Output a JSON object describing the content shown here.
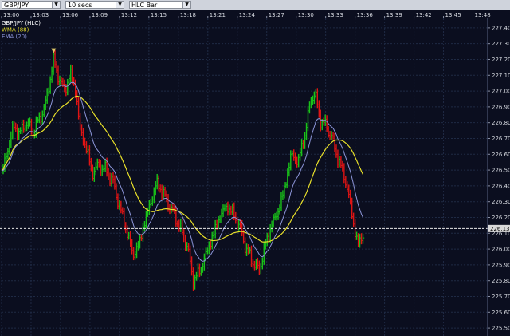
{
  "toolbar": {
    "symbol": "GBP/JPY",
    "interval": "10 secs",
    "style": "HLC Bar"
  },
  "colors": {
    "background": "#0b0e1f",
    "grid": "#1f2a44",
    "up_bar": "#19c219",
    "down_bar": "#e01414",
    "wma": "#e8e02a",
    "ema": "#8c95d8",
    "price_tag": "#d8d8d8"
  },
  "chart_data": {
    "type": "line",
    "title": "",
    "legend": [
      {
        "label": "GBP/JPY (HLC)",
        "color": "#ffffff"
      },
      {
        "label": "WMA (88)",
        "color": "#e8e02a"
      },
      {
        "label": "EMA (20)",
        "color": "#8c95d8"
      }
    ],
    "x_ticks": [
      "13:00",
      "13:03",
      "13:06",
      "13:09",
      "13:12",
      "13:15",
      "13:18",
      "13:21",
      "13:24",
      "13:27",
      "13:30",
      "13:33",
      "13:36",
      "13:39",
      "13:42",
      "13:45",
      "13:48"
    ],
    "y_ticks": [
      227.4,
      227.3,
      227.2,
      227.1,
      227.0,
      226.9,
      226.8,
      226.7,
      226.6,
      226.5,
      226.4,
      226.3,
      226.2,
      226.1,
      226.0,
      225.9,
      225.8,
      225.7,
      225.6,
      225.5
    ],
    "ylim": [
      225.45,
      227.46
    ],
    "xlim_minutes": [
      0,
      49.5
    ],
    "grid": true,
    "last_price": "226.13",
    "last_price_value": 226.13,
    "marker_peak": {
      "minute": 5.3,
      "price": 227.25
    },
    "price_path": [
      {
        "minute": 0.0,
        "price": 226.48
      },
      {
        "minute": 0.6,
        "price": 226.62
      },
      {
        "minute": 1.2,
        "price": 226.78
      },
      {
        "minute": 1.8,
        "price": 226.73
      },
      {
        "minute": 2.5,
        "price": 226.8
      },
      {
        "minute": 3.2,
        "price": 226.74
      },
      {
        "minute": 3.9,
        "price": 226.83
      },
      {
        "minute": 4.5,
        "price": 226.92
      },
      {
        "minute": 5.0,
        "price": 227.1
      },
      {
        "minute": 5.3,
        "price": 227.2
      },
      {
        "minute": 5.8,
        "price": 227.08
      },
      {
        "minute": 6.5,
        "price": 227.0
      },
      {
        "minute": 7.0,
        "price": 227.12
      },
      {
        "minute": 7.6,
        "price": 226.98
      },
      {
        "minute": 8.0,
        "price": 226.75
      },
      {
        "minute": 8.6,
        "price": 226.65
      },
      {
        "minute": 9.2,
        "price": 226.48
      },
      {
        "minute": 9.9,
        "price": 226.53
      },
      {
        "minute": 10.6,
        "price": 226.5
      },
      {
        "minute": 11.3,
        "price": 226.43
      },
      {
        "minute": 12.0,
        "price": 226.27
      },
      {
        "minute": 12.7,
        "price": 226.12
      },
      {
        "minute": 13.4,
        "price": 225.96
      },
      {
        "minute": 14.0,
        "price": 226.03
      },
      {
        "minute": 14.6,
        "price": 226.18
      },
      {
        "minute": 15.2,
        "price": 226.3
      },
      {
        "minute": 15.8,
        "price": 226.42
      },
      {
        "minute": 16.4,
        "price": 226.36
      },
      {
        "minute": 17.0,
        "price": 226.28
      },
      {
        "minute": 17.6,
        "price": 226.22
      },
      {
        "minute": 18.3,
        "price": 226.11
      },
      {
        "minute": 18.9,
        "price": 226.02
      },
      {
        "minute": 19.5,
        "price": 225.8
      },
      {
        "minute": 20.2,
        "price": 225.86
      },
      {
        "minute": 20.9,
        "price": 225.98
      },
      {
        "minute": 21.6,
        "price": 226.1
      },
      {
        "minute": 22.3,
        "price": 226.22
      },
      {
        "minute": 23.0,
        "price": 226.27
      },
      {
        "minute": 23.7,
        "price": 226.21
      },
      {
        "minute": 24.3,
        "price": 226.13
      },
      {
        "minute": 24.9,
        "price": 226.0
      },
      {
        "minute": 25.5,
        "price": 225.93
      },
      {
        "minute": 26.2,
        "price": 225.86
      },
      {
        "minute": 26.8,
        "price": 226.01
      },
      {
        "minute": 27.4,
        "price": 226.14
      },
      {
        "minute": 28.1,
        "price": 226.23
      },
      {
        "minute": 28.8,
        "price": 226.38
      },
      {
        "minute": 29.5,
        "price": 226.6
      },
      {
        "minute": 30.2,
        "price": 226.55
      },
      {
        "minute": 30.9,
        "price": 226.73
      },
      {
        "minute": 31.5,
        "price": 226.95
      },
      {
        "minute": 31.9,
        "price": 226.99
      },
      {
        "minute": 32.4,
        "price": 226.82
      },
      {
        "minute": 33.0,
        "price": 226.78
      },
      {
        "minute": 33.6,
        "price": 226.71
      },
      {
        "minute": 34.2,
        "price": 226.58
      },
      {
        "minute": 34.8,
        "price": 226.48
      },
      {
        "minute": 35.4,
        "price": 226.33
      },
      {
        "minute": 35.9,
        "price": 226.13
      },
      {
        "minute": 36.3,
        "price": 226.03
      },
      {
        "minute": 36.8,
        "price": 226.08
      }
    ]
  }
}
